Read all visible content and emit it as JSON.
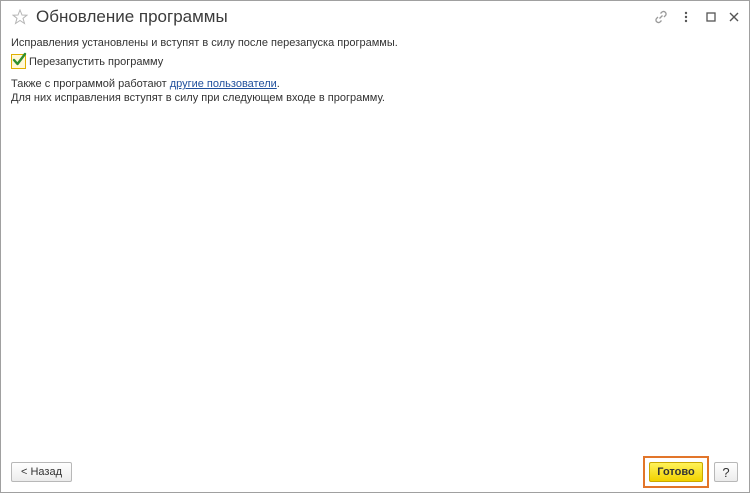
{
  "window": {
    "title": "Обновление программы"
  },
  "titlebar_icons": [
    "star-icon",
    "link-icon",
    "more-icon",
    "maximize-icon",
    "close-icon"
  ],
  "message": {
    "info": "Исправления установлены и вступят в силу после перезапуска программы.",
    "restart_checkbox": {
      "label": "Перезапустить программу",
      "checked": true
    },
    "also_prefix": "Также с программой работают ",
    "other_users_link": "другие пользователи",
    "also_suffix": ".",
    "next_login": "Для них исправления вступят в силу при следующем входе в программу."
  },
  "footer": {
    "back_label": "< Назад",
    "done_label": "Готово",
    "help_label": "?"
  },
  "colors": {
    "accent_button": "#f5db00",
    "highlight_border": "#e2752a",
    "link": "#1f4f9c",
    "checkbox_border": "#e0b000",
    "checkmark": "#2f8f2f"
  }
}
